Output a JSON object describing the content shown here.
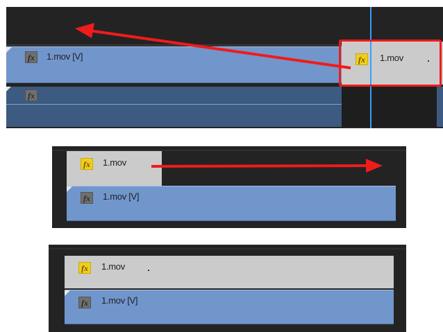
{
  "panel1": {
    "video_clip_label": "1.mov [V]",
    "moved_clip_label": "1.mov",
    "fx_icon": "fx",
    "highlight_color": "#f01b1b",
    "arrow_color": "#f01b1b",
    "playhead_color": "#3b9cff"
  },
  "panel2": {
    "moved_clip_label": "1.mov",
    "video_clip_label": "1.mov [V]",
    "fx_icon": "fx"
  },
  "panel3": {
    "moved_clip_label": "1.mov",
    "video_clip_label": "1.mov [V]",
    "fx_icon": "fx"
  },
  "colors": {
    "panel_bg": "#232323",
    "video_clip": "#7196cc",
    "moved_clip": "#cbcbcb",
    "fx_gold": "#f0cf1c",
    "fx_dark": "#6f6f6f"
  }
}
